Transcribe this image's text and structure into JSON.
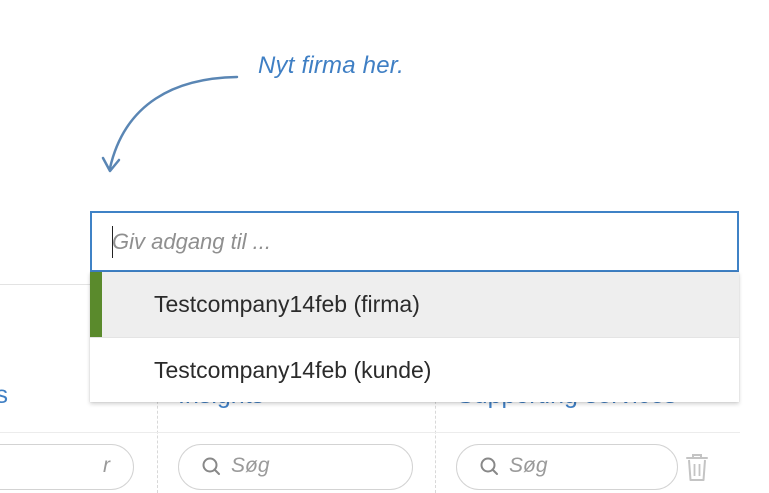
{
  "annotation": {
    "text": "Nyt firma her.",
    "color": "#3f7fc4"
  },
  "access_input": {
    "placeholder": "Giv adgang til ...",
    "value": ""
  },
  "dropdown": {
    "options": [
      {
        "label": "Testcompany14feb (firma)",
        "highlighted": true
      },
      {
        "label": "Testcompany14feb (kunde)",
        "highlighted": false
      }
    ],
    "highlight_color": "#5a8a2c"
  },
  "table": {
    "columns": [
      {
        "header": "ls",
        "search_placeholder": "r"
      },
      {
        "header": "Insights",
        "search_placeholder": "Søg"
      },
      {
        "header": "Supporting services",
        "search_placeholder": "Søg"
      }
    ]
  },
  "colors": {
    "accent": "#3f82c6",
    "text_blue": "#3f7fc4"
  },
  "icons": [
    "curved-arrow-icon",
    "search-icon",
    "trash-icon"
  ]
}
